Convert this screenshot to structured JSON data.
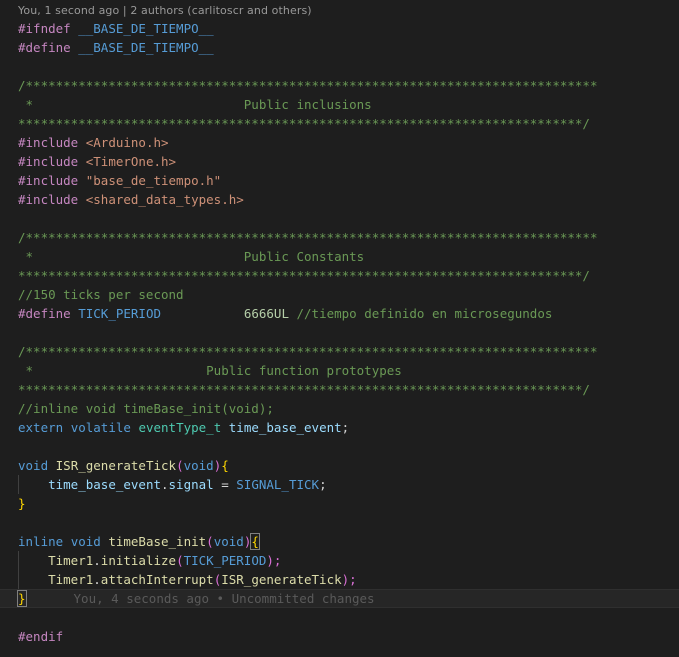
{
  "codelens": "You, 1 second ago | 2 authors (carlitoscr and others)",
  "lines": {
    "l1": [
      "#ifndef",
      " ",
      "__BASE_DE_TIEMPO__"
    ],
    "l2": [
      "#define",
      " ",
      "__BASE_DE_TIEMPO__"
    ],
    "c1a": "/****************************************************************************",
    "c1b": " *                            Public inclusions",
    "c1c": "***************************************************************************/",
    "inc1": [
      "#include",
      " ",
      "<Arduino.h>"
    ],
    "inc2": [
      "#include",
      " ",
      "<TimerOne.h>"
    ],
    "inc3": [
      "#include",
      " ",
      "\"base_de_tiempo.h\""
    ],
    "inc4": [
      "#include",
      " ",
      "<shared_data_types.h>"
    ],
    "c2a": "/****************************************************************************",
    "c2b": " *                            Public Constants",
    "c2c": "***************************************************************************/",
    "cm150": "//150 ticks per second",
    "def": [
      "#define",
      " ",
      "TICK_PERIOD",
      "           ",
      "6666UL",
      " ",
      "//tiempo definido en microsegundos"
    ],
    "c3a": "/****************************************************************************",
    "c3b": " *                       Public function prototypes",
    "c3c": "***************************************************************************/",
    "cmproto": "//inline void timeBase_init(void);",
    "ext": [
      "extern",
      " ",
      "volatile",
      " ",
      "eventType_t",
      " ",
      "time_base_event",
      ";"
    ],
    "isr": [
      "void",
      " ",
      "ISR_generateTick",
      "(",
      "void",
      ")",
      "{"
    ],
    "isrbody": [
      "    ",
      "time_base_event",
      ".",
      "signal",
      " = ",
      "SIGNAL_TICK",
      ";"
    ],
    "isrclose": "}",
    "tb": [
      "inline",
      " ",
      "void",
      " ",
      "timeBase_init",
      "(",
      "void",
      ")",
      "{"
    ],
    "tb1": [
      "    ",
      "Timer1",
      ".",
      "initialize",
      "(",
      "TICK_PERIOD",
      ");"
    ],
    "tb2": [
      "    ",
      "Timer1",
      ".",
      "attachInterrupt",
      "(",
      "ISR_generateTick",
      ");"
    ],
    "tbclose": "}",
    "blame": "You, 4 seconds ago • Uncommitted changes",
    "endif": "#endif"
  },
  "colors": {
    "background": "#1e1e1e",
    "comment": "#6a9955",
    "keyword": "#569cd6",
    "directive": "#c586c0",
    "string": "#ce9178",
    "function": "#dcdcaa",
    "type": "#4ec9b0",
    "variable": "#9cdcfe",
    "number": "#b5cea8"
  }
}
